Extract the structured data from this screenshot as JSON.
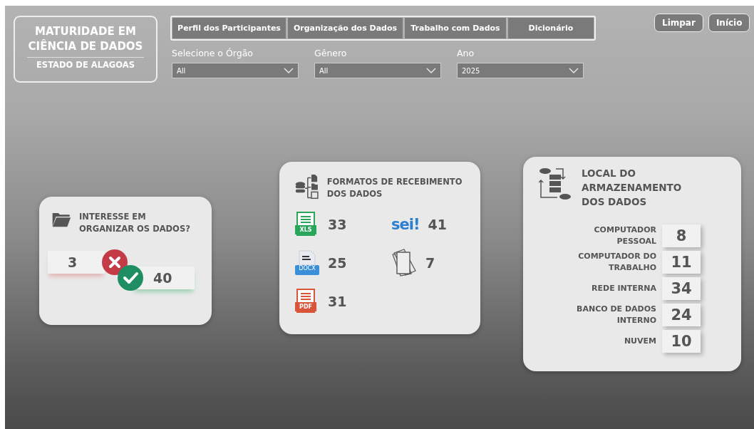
{
  "title": {
    "line1": "MATURIDADE EM",
    "line2": "CIÊNCIA DE DADOS",
    "subtitle": "ESTADO DE ALAGOAS"
  },
  "tabs": [
    {
      "label": "Perfil dos Participantes",
      "selected": false
    },
    {
      "label": "Organização dos Dados",
      "selected": false
    },
    {
      "label": "Trabalho com Dados",
      "selected": false
    },
    {
      "label": "Dicionário",
      "selected": false
    }
  ],
  "filters": [
    {
      "label": "Selecione o Órgão",
      "value": "All"
    },
    {
      "label": "Gênero",
      "value": "All"
    },
    {
      "label": "Ano",
      "value": "2025"
    }
  ],
  "buttons": [
    "Limpar",
    "Início"
  ],
  "interest_card": {
    "title": "INTERESSE EM ORGANIZAR OS DADOS?",
    "no": "3",
    "yes": "40"
  },
  "formats_card": {
    "title": "FORMATOS DE RECEBIMENTO DOS DADOS",
    "items": [
      {
        "kind": "xls",
        "label": "XLS",
        "value": "33"
      },
      {
        "kind": "sei",
        "label": "sei!",
        "value": "41"
      },
      {
        "kind": "docx",
        "label": "DOCX",
        "value": "25"
      },
      {
        "kind": "paper",
        "value": "7"
      },
      {
        "kind": "pdf",
        "label": "PDF",
        "value": "31"
      }
    ]
  },
  "storage_card": {
    "title": "LOCAL DO ARMAZENAMENTO DOS DADOS",
    "rows": [
      {
        "label": "COMPUTADOR PESSOAL",
        "value": "8"
      },
      {
        "label": "COMPUTADOR DO TRABALHO",
        "value": "11"
      },
      {
        "label": "REDE INTERNA",
        "value": "34"
      },
      {
        "label": "BANCO DE DADOS INTERNO",
        "value": "24"
      },
      {
        "label": "NUVEM",
        "value": "10"
      }
    ]
  }
}
